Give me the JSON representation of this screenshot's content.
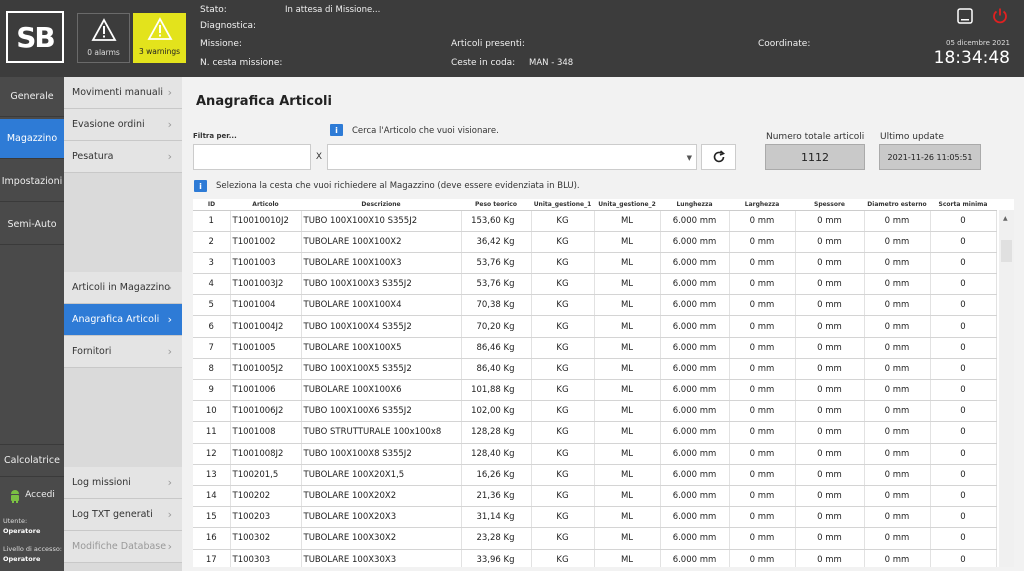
{
  "header": {
    "logo_text": "SB",
    "alarms_label": "0 alarms",
    "warnings_label": "3 warnings",
    "stato_label": "Stato:",
    "stato_value": "In attesa di Missione...",
    "diagnostica_label": "Diagnostica:",
    "missione_label": "Missione:",
    "cesta_label": "N. cesta missione:",
    "articoli_presenti_label": "Articoli presenti:",
    "ceste_coda_label": "Ceste in coda:",
    "ceste_coda_value": "MAN - 348",
    "coordinate_label": "Coordinate:",
    "date": "05 dicembre 2021",
    "time": "18:34:48"
  },
  "leftnav": {
    "items": [
      "Generale",
      "Magazzino",
      "Impostazioni",
      "Semi-Auto"
    ],
    "calcolatrice": "Calcolatrice",
    "accedi": "Accedi",
    "utente_label": "Utente:",
    "utente_value": "Operatore",
    "livello_label": "Livello di accesso:",
    "livello_value": "Operatore"
  },
  "subnav": {
    "top_items": [
      "Movimenti manuali",
      "Evasione ordini",
      "Pesatura"
    ],
    "mid_items": [
      "Articoli in Magazzino",
      "Anagrafica Articoli",
      "Fornitori"
    ],
    "bottom_items": [
      "Log missioni",
      "Log TXT generati",
      "Modifiche Database"
    ]
  },
  "main": {
    "title": "Anagrafica Articoli",
    "filter_label": "Filtra per...",
    "clear_label": "X",
    "search_hint": "Cerca l'Articolo che vuoi visionare.",
    "select_hint": "Seleziona la cesta che vuoi richiedere al Magazzino (deve essere evidenziata in BLU).",
    "total_label": "Numero totale articoli",
    "total_value": "1112",
    "update_label": "Ultimo update",
    "update_value": "2021-11-26 11:05:51"
  },
  "table": {
    "columns": [
      "ID",
      "Articolo",
      "Descrizione",
      "Peso teorico",
      "Unita_gestione_1",
      "Unita_gestione_2",
      "Lunghezza",
      "Larghezza",
      "Spessore",
      "Diametro esterno",
      "Scorta minima"
    ],
    "rows": [
      [
        "1",
        "T10010010J2",
        "TUBO 100X100X10 S355J2",
        "153,60 Kg",
        "KG",
        "ML",
        "6.000 mm",
        "0 mm",
        "0 mm",
        "0 mm",
        "0"
      ],
      [
        "2",
        "T1001002",
        "TUBOLARE 100X100X2",
        "36,42 Kg",
        "KG",
        "ML",
        "6.000 mm",
        "0 mm",
        "0 mm",
        "0 mm",
        "0"
      ],
      [
        "3",
        "T1001003",
        "TUBOLARE 100X100X3",
        "53,76 Kg",
        "KG",
        "ML",
        "6.000 mm",
        "0 mm",
        "0 mm",
        "0 mm",
        "0"
      ],
      [
        "4",
        "T1001003J2",
        "TUBO 100X100X3 S355J2",
        "53,76 Kg",
        "KG",
        "ML",
        "6.000 mm",
        "0 mm",
        "0 mm",
        "0 mm",
        "0"
      ],
      [
        "5",
        "T1001004",
        "TUBOLARE 100X100X4",
        "70,38 Kg",
        "KG",
        "ML",
        "6.000 mm",
        "0 mm",
        "0 mm",
        "0 mm",
        "0"
      ],
      [
        "6",
        "T1001004J2",
        "TUBO 100X100X4 S355J2",
        "70,20 Kg",
        "KG",
        "ML",
        "6.000 mm",
        "0 mm",
        "0 mm",
        "0 mm",
        "0"
      ],
      [
        "7",
        "T1001005",
        "TUBOLARE 100X100X5",
        "86,46 Kg",
        "KG",
        "ML",
        "6.000 mm",
        "0 mm",
        "0 mm",
        "0 mm",
        "0"
      ],
      [
        "8",
        "T1001005J2",
        "TUBO 100X100X5 S355J2",
        "86,40 Kg",
        "KG",
        "ML",
        "6.000 mm",
        "0 mm",
        "0 mm",
        "0 mm",
        "0"
      ],
      [
        "9",
        "T1001006",
        "TUBOLARE 100X100X6",
        "101,88 Kg",
        "KG",
        "ML",
        "6.000 mm",
        "0 mm",
        "0 mm",
        "0 mm",
        "0"
      ],
      [
        "10",
        "T1001006J2",
        "TUBO 100X100X6 S355J2",
        "102,00 Kg",
        "KG",
        "ML",
        "6.000 mm",
        "0 mm",
        "0 mm",
        "0 mm",
        "0"
      ],
      [
        "11",
        "T1001008",
        "TUBO STRUTTURALE 100x100x8",
        "128,28 Kg",
        "KG",
        "ML",
        "6.000 mm",
        "0 mm",
        "0 mm",
        "0 mm",
        "0"
      ],
      [
        "12",
        "T1001008J2",
        "TUBO 100X100X8 S355J2",
        "128,40 Kg",
        "KG",
        "ML",
        "6.000 mm",
        "0 mm",
        "0 mm",
        "0 mm",
        "0"
      ],
      [
        "13",
        "T100201,5",
        "TUBOLARE 100X20X1,5",
        "16,26 Kg",
        "KG",
        "ML",
        "6.000 mm",
        "0 mm",
        "0 mm",
        "0 mm",
        "0"
      ],
      [
        "14",
        "T100202",
        "TUBOLARE 100X20X2",
        "21,36 Kg",
        "KG",
        "ML",
        "6.000 mm",
        "0 mm",
        "0 mm",
        "0 mm",
        "0"
      ],
      [
        "15",
        "T100203",
        "TUBOLARE 100X20X3",
        "31,14 Kg",
        "KG",
        "ML",
        "6.000 mm",
        "0 mm",
        "0 mm",
        "0 mm",
        "0"
      ],
      [
        "16",
        "T100302",
        "TUBOLARE 100X30X2",
        "23,28 Kg",
        "KG",
        "ML",
        "6.000 mm",
        "0 mm",
        "0 mm",
        "0 mm",
        "0"
      ],
      [
        "17",
        "T100303",
        "TUBOLARE 100X30X3",
        "33,96 Kg",
        "KG",
        "ML",
        "6.000 mm",
        "0 mm",
        "0 mm",
        "0 mm",
        "0"
      ]
    ]
  },
  "colors": {
    "accent": "#2e7bd6",
    "header_bg": "#3c3c3c",
    "warning": "#e3e31c",
    "power": "#e02020"
  }
}
